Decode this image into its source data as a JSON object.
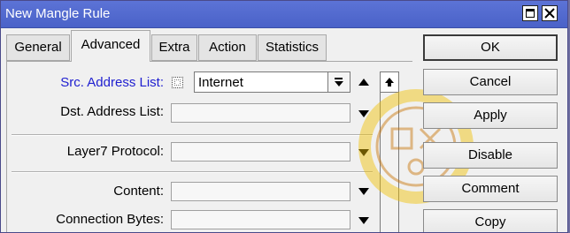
{
  "window": {
    "title": "New Mangle Rule"
  },
  "tabs": [
    {
      "label": "General",
      "active": false
    },
    {
      "label": "Advanced",
      "active": true
    },
    {
      "label": "Extra",
      "active": false
    },
    {
      "label": "Action",
      "active": false
    },
    {
      "label": "Statistics",
      "active": false
    }
  ],
  "form": {
    "src_address_list": {
      "label": "Src. Address List:",
      "value": "Internet",
      "negated": false
    },
    "dst_address_list": {
      "label": "Dst. Address List:",
      "value": ""
    },
    "layer7_protocol": {
      "label": "Layer7 Protocol:",
      "value": ""
    },
    "content": {
      "label": "Content:",
      "value": ""
    },
    "connection_bytes": {
      "label": "Connection Bytes:",
      "value": ""
    }
  },
  "buttons": {
    "ok": "OK",
    "cancel": "Cancel",
    "apply": "Apply",
    "disable": "Disable",
    "comment": "Comment",
    "copy": "Copy"
  },
  "colors": {
    "titlebar": "#4a62c8",
    "highlight_label": "#2020d0",
    "window_bg": "#f0f0f0"
  },
  "icons": [
    "restore-icon",
    "close-icon",
    "dropdown-arrow-icon",
    "up-arrow-icon",
    "scroll-up-icon"
  ]
}
